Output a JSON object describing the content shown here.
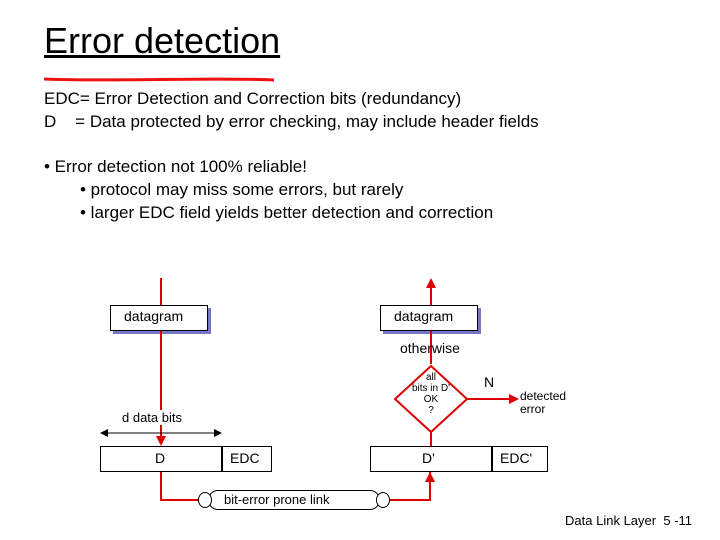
{
  "title": "Error detection",
  "definitions": {
    "edc": "EDC= Error Detection and Correction bits (redundancy)",
    "d": "D    = Data protected by error checking, may include header fields"
  },
  "bullets": {
    "b0": "• Error detection not 100% reliable!",
    "b1": "• protocol may miss some errors, but rarely",
    "b2": "• larger EDC field yields better detection and correction"
  },
  "diagram": {
    "datagram_left": "datagram",
    "datagram_right": "datagram",
    "d_bits_label": "d data bits",
    "D": "D",
    "EDC": "EDC",
    "D_prime": "D'",
    "EDC_prime": "EDC'",
    "decision": "all\nbits in D'\nOK\n?",
    "N": "N",
    "detected_error": "detected\nerror",
    "otherwise": "otherwise",
    "link": "bit-error prone link"
  },
  "footer": {
    "section": "Data Link Layer",
    "page": "5 -11"
  }
}
